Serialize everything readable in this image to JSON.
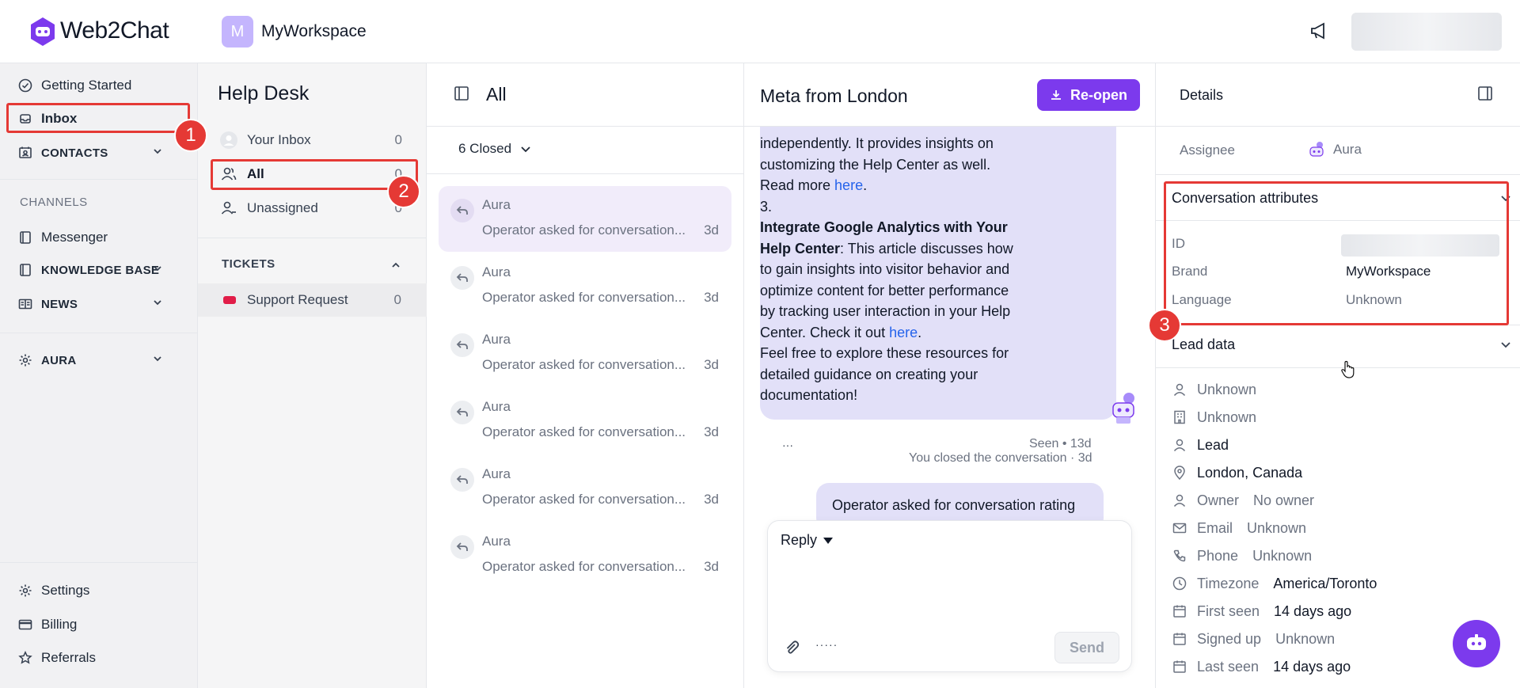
{
  "brand": {
    "name": "Web2Chat"
  },
  "nav": {
    "getting_started": "Getting Started",
    "inbox": "Inbox",
    "contacts": "CONTACTS",
    "channels_label": "CHANNELS",
    "messenger": "Messenger",
    "knowledge_base": "KNOWLEDGE BASE",
    "news": "NEWS",
    "aura": "AURA",
    "settings": "Settings",
    "billing": "Billing",
    "referrals": "Referrals"
  },
  "workspace": {
    "initial": "M",
    "name": "MyWorkspace"
  },
  "helpdesk": {
    "title": "Help Desk",
    "items": [
      {
        "label": "Your Inbox",
        "count": "0"
      },
      {
        "label": "All",
        "count": "0"
      },
      {
        "label": "Unassigned",
        "count": "0"
      }
    ],
    "tickets_label": "TICKETS",
    "support_request": {
      "label": "Support Request",
      "count": "0"
    }
  },
  "list": {
    "title": "All",
    "filter": "6 Closed",
    "conversations": [
      {
        "name": "Aura",
        "preview": "Operator asked for conversation...",
        "time": "3d"
      },
      {
        "name": "Aura",
        "preview": "Operator asked for conversation...",
        "time": "3d"
      },
      {
        "name": "Aura",
        "preview": "Operator asked for conversation...",
        "time": "3d"
      },
      {
        "name": "Aura",
        "preview": "Operator asked for conversation...",
        "time": "3d"
      },
      {
        "name": "Aura",
        "preview": "Operator asked for conversation...",
        "time": "3d"
      },
      {
        "name": "Aura",
        "preview": "Operator asked for conversation...",
        "time": "3d"
      }
    ]
  },
  "chat": {
    "title": "Meta from London",
    "reopen_label": "Re-open",
    "msg_line1": "independently. It provides insights on",
    "msg_line2": "customizing the Help Center as well.",
    "msg_line3_pre": "Read more ",
    "link_here": "here",
    "msg_line3_post": ".",
    "item3_num": "3.",
    "item3_bold": "Integrate Google Analytics with Your",
    "item3_bold2": "Help Center",
    "item3_text1": ": This article discusses how",
    "item3_text2": "to gain insights into visitor behavior and",
    "item3_text3": "optimize content for better performance",
    "item3_text4": "by tracking user interaction in your Help",
    "item3_text5_pre": "Center. Check it out ",
    "item3_text5_post": ".",
    "outro1": "Feel free to explore these resources for",
    "outro2": "detailed guidance on creating your",
    "outro3": "documentation!",
    "dots": "···",
    "seen": "Seen • 13d",
    "closed_note": "You closed the conversation · 3d",
    "operator_msg": "Operator asked for conversation rating",
    "composer": {
      "mode": "Reply",
      "more": "·····",
      "send": "Send"
    }
  },
  "details": {
    "title": "Details",
    "assignee_label": "Assignee",
    "assignee_value": "Aura",
    "attributes_title": "Conversation attributes",
    "attributes": {
      "id_label": "ID",
      "brand_label": "Brand",
      "brand_value": "MyWorkspace",
      "language_label": "Language",
      "language_value": "Unknown"
    },
    "lead_title": "Lead data",
    "lead": {
      "name": "Unknown",
      "company": "Unknown",
      "type": "Lead",
      "location": "London, Canada",
      "owner_label": "Owner",
      "owner_value": "No owner",
      "email_label": "Email",
      "email_value": "Unknown",
      "phone_label": "Phone",
      "phone_value": "Unknown",
      "timezone_label": "Timezone",
      "timezone_value": "America/Toronto",
      "first_seen_label": "First seen",
      "first_seen_value": "14 days ago",
      "signed_up_label": "Signed up",
      "signed_up_value": "Unknown",
      "last_seen_label": "Last seen",
      "last_seen_value": "14 days ago"
    }
  },
  "annotations": {
    "b1": "1",
    "b2": "2",
    "b3": "3"
  },
  "colors": {
    "accent": "#7c3aed",
    "annotation": "#e53935",
    "bubble": "#e2e0f8"
  }
}
